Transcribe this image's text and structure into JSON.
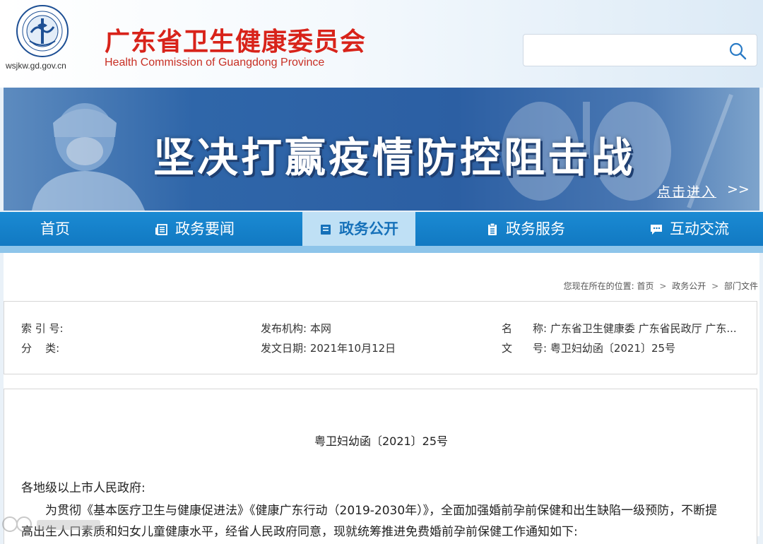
{
  "header": {
    "site_url": "wsjkw.gd.gov.cn",
    "title": "广东省卫生健康委员会",
    "subtitle": "Health Commission of Guangdong Province",
    "search_placeholder": ""
  },
  "banner": {
    "title": "坚决打赢疫情防控阻击战",
    "link": "点击进入",
    "link_arrow": ">>"
  },
  "nav": {
    "items": [
      {
        "label": "首页"
      },
      {
        "label": "政务要闻"
      },
      {
        "label": "政务公开"
      },
      {
        "label": "政务服务"
      },
      {
        "label": "互动交流"
      }
    ]
  },
  "breadcrumb": {
    "prefix": "您现在所在的位置:",
    "items": [
      "首页",
      "政务公开",
      "部门文件"
    ],
    "sep": ">"
  },
  "meta": {
    "index_label": "索 引 号:",
    "index_value": "",
    "category_label": "分    类:",
    "category_value": "",
    "publisher": "发布机构: 本网",
    "date": "发文日期: 2021年10月12日",
    "name_label": "名",
    "name_value": "称: 广东省卫生健康委 广东省民政厅 广东...",
    "docno_label": "文",
    "docno_value": "号: 粤卫妇幼函〔2021〕25号"
  },
  "document": {
    "number": "粤卫妇幼函〔2021〕25号",
    "salutation": "各地级以上市人民政府:",
    "para1_line1": "为贯彻《基本医疗卫生与健康促进法》《健康广东行动（2019-2030年）》，全面加强婚前孕前保健和出生缺陷一级预防，不断提",
    "para1_line2": "高出生人口素质和妇女儿童健康水平，经省人民政府同意，现就统筹推进免费婚前孕前保健工作通知如下:"
  },
  "colors": {
    "title_red": "#d8231a",
    "nav_blue": "#1179c2",
    "nav_active_bg": "#bfe0f5"
  }
}
